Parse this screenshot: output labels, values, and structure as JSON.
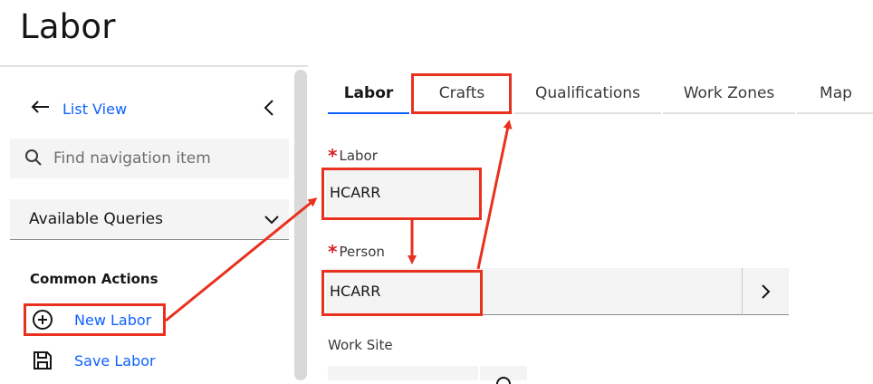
{
  "page": {
    "title": "Labor"
  },
  "sidebar": {
    "list_view": "List View",
    "search_placeholder": "Find navigation item",
    "queries_label": "Available Queries",
    "common_actions_heading": "Common Actions",
    "actions": [
      {
        "label": "New Labor",
        "icon": "add-circle-icon"
      },
      {
        "label": "Save Labor",
        "icon": "save-icon"
      }
    ]
  },
  "tabs": [
    {
      "label": "Labor",
      "active": true
    },
    {
      "label": "Crafts",
      "active": false
    },
    {
      "label": "Qualifications",
      "active": false
    },
    {
      "label": "Work Zones",
      "active": false
    },
    {
      "label": "Map",
      "active": false
    }
  ],
  "form": {
    "labor": {
      "label": "Labor",
      "required": true,
      "value": "HCARR"
    },
    "person": {
      "label": "Person",
      "required": true,
      "value": "HCARR"
    },
    "work_site": {
      "label": "Work Site",
      "required": false,
      "value": ""
    }
  },
  "colors": {
    "link": "#0f62fe",
    "annotation": "#e8311e",
    "required": "#da1e28"
  }
}
